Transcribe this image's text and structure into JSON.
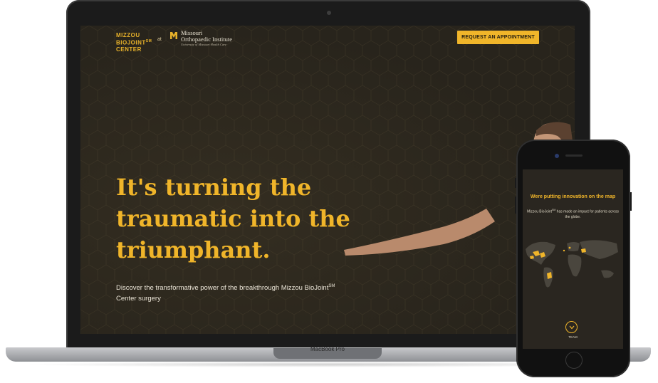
{
  "laptop": {
    "base_label": "MacBook Pro",
    "site": {
      "logo_lines": [
        "MIZZOU",
        "BIOJOINT",
        "CENTER"
      ],
      "logo_mark": "SM",
      "at_text": "at",
      "institute_lines": [
        "Missouri",
        "Orthopaedic Institute"
      ],
      "institute_sub": "University of Missouri Health Care",
      "cta_label": "REQUEST AN APPOINTMENT",
      "headline_lines": [
        "It's turning the",
        "traumatic into the",
        "triumphant."
      ],
      "sub_pre": "Discover the transformative power of the breakthrough Mizzou BioJoint",
      "sub_sup": "SM",
      "sub_post": "Center surgery"
    }
  },
  "phone": {
    "title": "Were putting innovation on the map",
    "body_pre": "Mizzou BioJoint",
    "body_sup": "SM",
    "body_post": " has made an impact for patients across the globe.",
    "scroll_icon": "chevron-down-icon",
    "team_label": "TEAM"
  },
  "colors": {
    "accent": "#f0b52a",
    "background": "#28241c"
  }
}
